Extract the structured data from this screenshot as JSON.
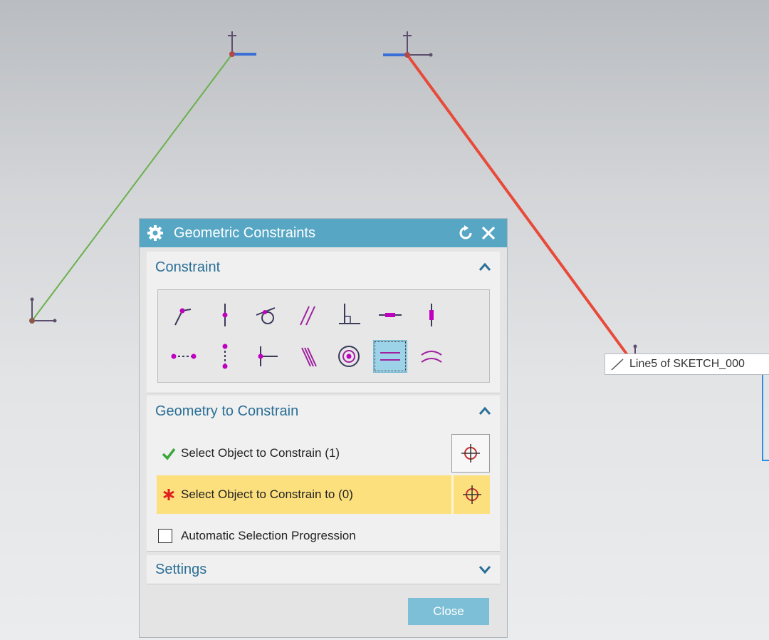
{
  "tooltip": {
    "text": "Line5 of SKETCH_000",
    "icon": "line-icon"
  },
  "dialog": {
    "title": "Geometric Constraints",
    "title_icons": [
      "gear-icon",
      "reset-icon",
      "close-icon"
    ],
    "sections": {
      "constraint": {
        "label": "Constraint",
        "expanded": true,
        "icons": [
          "coincident-icon",
          "point-on-curve-icon",
          "tangent-icon",
          "parallel-icon",
          "perpendicular-icon",
          "horizontal-icon",
          "vertical-icon",
          "horizontal-alignment-icon",
          "vertical-alignment-icon",
          "midpoint-icon",
          "collinear-icon",
          "concentric-icon",
          "equal-length-icon",
          "equal-radius-icon"
        ],
        "selected_icon": "equal-length-icon"
      },
      "geometry": {
        "label": "Geometry to Constrain",
        "expanded": true,
        "select_object": {
          "label": "Select Object to Constrain (1)",
          "status": "complete"
        },
        "select_target": {
          "label": "Select Object to Constrain to (0)",
          "status": "required"
        },
        "auto_progression": {
          "label": "Automatic Selection Progression",
          "checked": false
        }
      },
      "settings": {
        "label": "Settings",
        "expanded": false
      }
    },
    "close_label": "Close"
  },
  "colors": {
    "title_bar": "#56a6c4",
    "section_text": "#2a6f96",
    "active_row": "#fde07e",
    "icon_magenta": "#c000c0",
    "line_green": "#6ab04c",
    "line_red": "#e84a3a",
    "close_button": "#7dbfd6"
  }
}
